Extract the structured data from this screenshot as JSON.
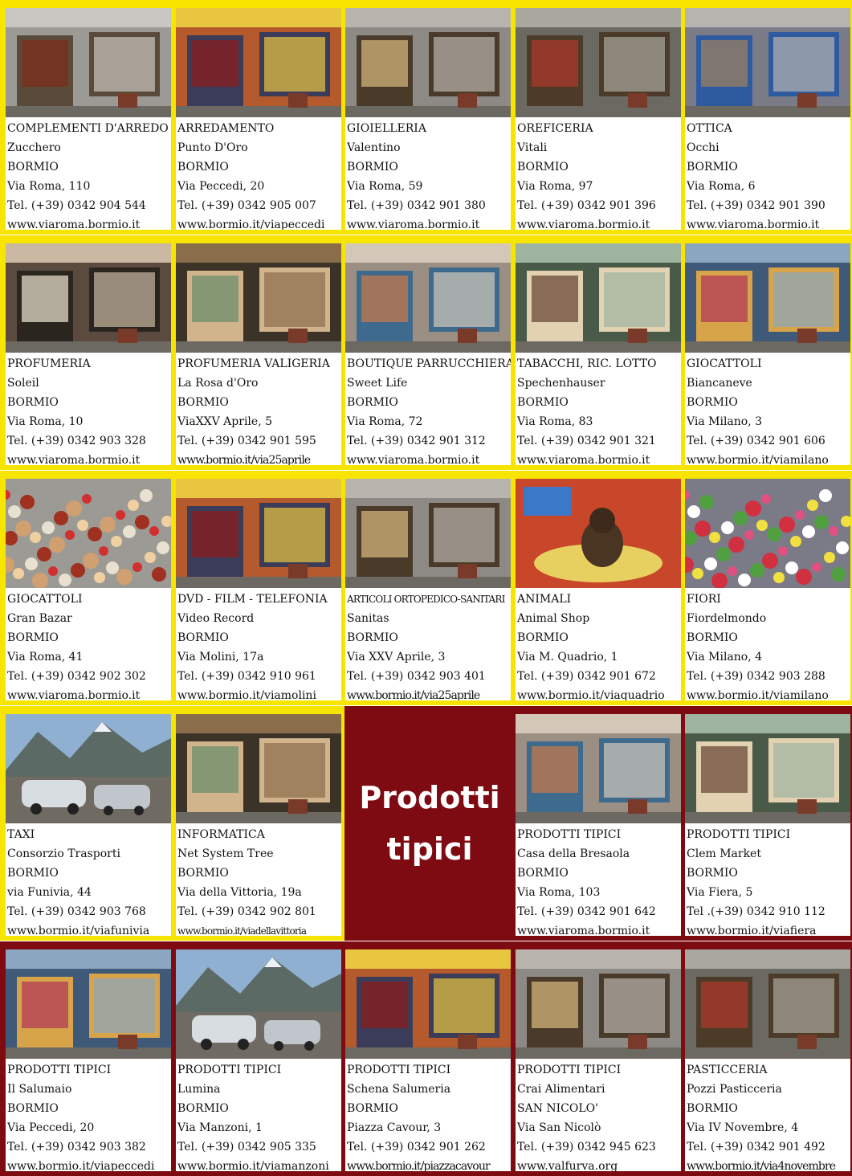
{
  "headline": "Prodotti\ntipici",
  "palette": {
    "yellow": "#f7e500",
    "dark_red": "#7e0a12"
  },
  "rows": [
    {
      "frame": "yellow",
      "cells": [
        {
          "category": "COMPLEMENTI D'ARREDO",
          "name": "Zucchero",
          "town": "BORMIO",
          "address": "Via Roma, 110",
          "phone": "Tel. (+39) 0342 904 544",
          "web": "www.viaroma.bormio.it",
          "photo": "shop-front-photo"
        },
        {
          "category": "ARREDAMENTO",
          "name": "Punto D'Oro",
          "town": "BORMIO",
          "address": "Via Peccedi, 20",
          "phone": "Tel. (+39) 0342 905 007",
          "web": "www.bormio.it/viapeccedi",
          "photo": "shop-front-photo"
        },
        {
          "category": "GIOIELLERIA",
          "name": "Valentino",
          "town": "BORMIO",
          "address": "Via Roma, 59",
          "phone": "Tel. (+39) 0342 901 380",
          "web": "www.viaroma.bormio.it",
          "photo": "shop-front-photo"
        },
        {
          "category": "OREFICERIA",
          "name": "Vitali",
          "town": "BORMIO",
          "address": "Via Roma, 97",
          "phone": "Tel. (+39) 0342 901 396",
          "web": "www.viaroma.bormio.it",
          "photo": "shop-front-photo"
        },
        {
          "category": "OTTICA",
          "name": "Occhi",
          "town": "BORMIO",
          "address": "Via Roma, 6",
          "phone": "Tel. (+39) 0342 901 390",
          "web": "www.viaroma.bormio.it",
          "photo": "shop-front-photo"
        }
      ]
    },
    {
      "frame": "yellow",
      "cells": [
        {
          "category": "PROFUMERIA",
          "name": "Soleil",
          "town": "BORMIO",
          "address": "Via Roma, 10",
          "phone": "Tel. (+39) 0342 903 328",
          "web": "www.viaroma.bormio.it",
          "photo": "shop-window-photo"
        },
        {
          "category": "PROFUMERIA VALIGERIA",
          "name": "La Rosa d'Oro",
          "town": "BORMIO",
          "address": "ViaXXV Aprile, 5",
          "phone": "Tel. (+39) 0342 901 595",
          "web": "www.bormio.it/via25aprile",
          "photo": "shop-window-photo"
        },
        {
          "category": "BOUTIQUE PARRUCCHIERA",
          "name": "Sweet Life",
          "town": "BORMIO",
          "address": "Via Roma, 72",
          "phone": "Tel. (+39) 0342 901 312",
          "web": "www.viaroma.bormio.it",
          "photo": "shop-window-photo"
        },
        {
          "category": "TABACCHI, RIC. LOTTO",
          "name": "Spechenhauser",
          "town": "BORMIO",
          "address": "Via Roma, 83",
          "phone": "Tel. (+39) 0342 901 321",
          "web": "www.viaroma.bormio.it",
          "photo": "shop-window-photo"
        },
        {
          "category": "GIOCATTOLI",
          "name": "Biancaneve",
          "town": "BORMIO",
          "address": "Via Milano, 3",
          "phone": "Tel. (+39) 0342 901 606",
          "web": "www.bormio.it/viamilano",
          "photo": "shop-window-photo"
        }
      ]
    },
    {
      "frame": "yellow",
      "cells": [
        {
          "category": "GIOCATTOLI",
          "name": "Gran Bazar",
          "town": "BORMIO",
          "address": "Via Roma, 41",
          "phone": "Tel. (+39) 0342 902 302",
          "web": "www.viaroma.bormio.it",
          "photo": "toy-shop-photo"
        },
        {
          "category": "DVD - FILM - TELEFONIA",
          "name": "Video Record",
          "town": "BORMIO",
          "address": "Via Molini, 17a",
          "phone": "Tel. (+39) 0342 910 961",
          "web": "www.bormio.it/viamolini",
          "photo": "shop-front-photo"
        },
        {
          "category": "ARTICOLI ORTOPEDICO-SANITARI",
          "name": "Sanitas",
          "town": "BORMIO",
          "address": "Via XXV Aprile, 3",
          "phone": "Tel. (+39) 0342 903 401",
          "web": "www.bormio.it/via25aprile",
          "photo": "shop-window-photo"
        },
        {
          "category": "ANIMALI",
          "name": "Animal Shop",
          "town": "BORMIO",
          "address": "Via M. Quadrio, 1",
          "phone": "Tel. (+39) 0342 901 672",
          "web": "www.bormio.it/viaquadrio",
          "photo": "pet-shop-photo"
        },
        {
          "category": "FIORI",
          "name": "Fiordelmondo",
          "town": "BORMIO",
          "address": "Via Milano, 4",
          "phone": "Tel. (+39) 0342 903 288",
          "web": "www.bormio.it/viamilano",
          "photo": "flower-shop-photo"
        }
      ]
    },
    {
      "frame": "mixed",
      "cells": [
        {
          "category": "TAXI",
          "name": "Consorzio Trasporti",
          "town": "BORMIO",
          "address": "via Funivia, 44",
          "phone": "Tel. (+39) 0342 903 768",
          "web": "www.bormio.it/viafunivia",
          "photo": "taxi-photo"
        },
        {
          "category": "INFORMATICA",
          "name": "Net System Tree",
          "town": "BORMIO",
          "address": "Via della Vittoria, 19a",
          "phone": "Tel. (+39) 0342 902 801",
          "web": "www.bormio.it/viadellavittoria",
          "photo": "shop-front-photo"
        },
        {
          "promo": true
        },
        {
          "category": "PRODOTTI TIPICI",
          "name": "Casa della Bresaola",
          "town": "BORMIO",
          "address": "Via Roma, 103",
          "phone": "Tel. (+39) 0342 901 642",
          "web": "www.viaroma.bormio.it",
          "photo": "shop-window-photo"
        },
        {
          "category": "PRODOTTI TIPICI",
          "name": "Clem Market",
          "town": "BORMIO",
          "address": "Via Fiera, 5",
          "phone": "Tel .(+39) 0342 910 112",
          "web": "www.bormio.it/viafiera",
          "photo": "shop-front-photo"
        }
      ]
    },
    {
      "frame": "red",
      "cells": [
        {
          "category": "PRODOTTI TIPICI",
          "name": "Il Salumaio",
          "town": "BORMIO",
          "address": "Via Peccedi, 20",
          "phone": "Tel. (+39) 0342 903 382",
          "web": "www.bormio.it/viapeccedi",
          "photo": "shop-front-photo"
        },
        {
          "category": "PRODOTTI TIPICI",
          "name": "Lumina",
          "town": "BORMIO",
          "address": "Via Manzoni, 1",
          "phone": "Tel. (+39) 0342 905 335",
          "web": "www.bormio.it/viamanzoni",
          "photo": "mountain-shop-photo"
        },
        {
          "category": "PRODOTTI TIPICI",
          "name": "Schena Salumeria",
          "town": "BORMIO",
          "address": "Piazza Cavour, 3",
          "phone": "Tel. (+39) 0342 901 262",
          "web": "www.bormio.it/piazzacavour",
          "photo": "shop-front-photo"
        },
        {
          "category": "PRODOTTI TIPICI",
          "name": "Crai Alimentari",
          "town": "SAN NICOLO'",
          "address": "Via San Nicolò",
          "phone": "Tel. (+39) 0342 945 623",
          "web": "www.valfurva.org",
          "photo": "shop-front-photo"
        },
        {
          "category": "PASTICCERIA",
          "name": "Pozzi Pasticceria",
          "town": "BORMIO",
          "address": "Via IV Novembre, 4",
          "phone": "Tel. (+39) 0342 901 492",
          "web": "www.bormio.it/via4novembre",
          "photo": "shop-front-photo"
        }
      ]
    }
  ]
}
